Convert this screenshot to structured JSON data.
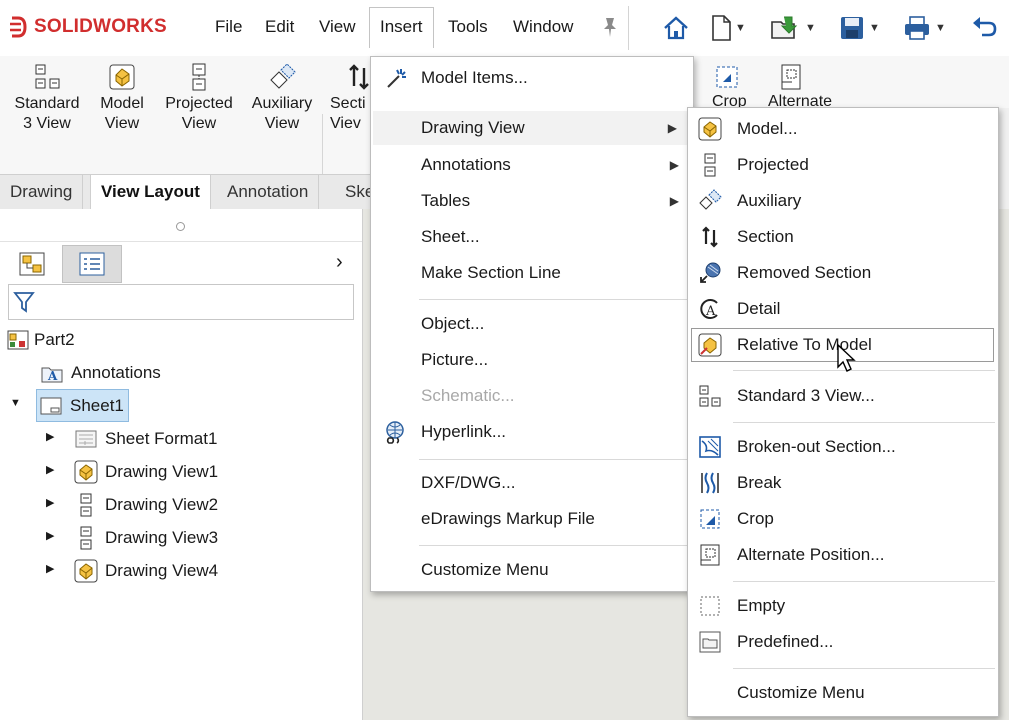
{
  "app": {
    "logo_text": "SOLIDWORKS"
  },
  "menubar": [
    "File",
    "Edit",
    "View",
    "Insert",
    "Tools",
    "Window"
  ],
  "ribbon": {
    "buttons": [
      {
        "line1": "Standard",
        "line2": "3 View"
      },
      {
        "line1": "Model",
        "line2": "View"
      },
      {
        "line1": "Projected",
        "line2": "View"
      },
      {
        "line1": "Auxiliary",
        "line2": "View"
      },
      {
        "line1": "Secti",
        "line2": "Viev"
      }
    ],
    "behind": [
      {
        "line1": "Crop"
      },
      {
        "line1": "Alternate"
      }
    ]
  },
  "tabs": [
    "Drawing",
    "View Layout",
    "Annotation",
    "Ske"
  ],
  "active_tab": "View Layout",
  "feature_tree": {
    "root": "Part2",
    "items": [
      {
        "label": "Annotations",
        "icon": "annotations-icon"
      },
      {
        "label": "Sheet1",
        "icon": "sheet-icon",
        "expanded": true,
        "selected": true
      },
      {
        "label": "Sheet Format1",
        "icon": "sheet-format-icon"
      },
      {
        "label": "Drawing View1",
        "icon": "model-view-icon"
      },
      {
        "label": "Drawing View2",
        "icon": "projected-view-icon"
      },
      {
        "label": "Drawing View3",
        "icon": "projected-view-icon"
      },
      {
        "label": "Drawing View4",
        "icon": "model-view-icon"
      }
    ]
  },
  "insert_menu": {
    "items": [
      {
        "label": "Model Items...",
        "icon": "model-items-icon"
      },
      {
        "label": "Drawing View",
        "submenu": true,
        "highlighted": true
      },
      {
        "label": "Annotations",
        "submenu": true
      },
      {
        "label": "Tables",
        "submenu": true
      },
      {
        "label": "Sheet..."
      },
      {
        "label": "Make Section Line"
      },
      {
        "label": "Object..."
      },
      {
        "label": "Picture..."
      },
      {
        "label": "Schematic...",
        "disabled": true
      },
      {
        "label": "Hyperlink...",
        "icon": "hyperlink-icon"
      },
      {
        "label": "DXF/DWG..."
      },
      {
        "label": "eDrawings Markup File"
      },
      {
        "label": "Customize Menu"
      }
    ]
  },
  "drawing_view_menu": {
    "items": [
      {
        "label": "Model...",
        "icon": "model-view-icon"
      },
      {
        "label": "Projected",
        "icon": "projected-view-icon"
      },
      {
        "label": "Auxiliary",
        "icon": "auxiliary-view-icon"
      },
      {
        "label": "Section",
        "icon": "section-view-icon"
      },
      {
        "label": "Removed Section",
        "icon": "removed-section-icon"
      },
      {
        "label": "Detail",
        "icon": "detail-view-icon"
      },
      {
        "label": "Relative To Model",
        "icon": "relative-view-icon",
        "hovered": true
      },
      {
        "label": "Standard 3 View...",
        "icon": "standard-3-view-icon"
      },
      {
        "label": "Broken-out Section...",
        "icon": "broken-out-section-icon"
      },
      {
        "label": "Break",
        "icon": "break-icon"
      },
      {
        "label": "Crop",
        "icon": "crop-icon"
      },
      {
        "label": "Alternate Position...",
        "icon": "alternate-position-icon"
      },
      {
        "label": "Empty",
        "icon": "empty-view-icon"
      },
      {
        "label": "Predefined...",
        "icon": "predefined-view-icon"
      },
      {
        "label": "Customize Menu"
      }
    ]
  },
  "colors": {
    "brand_red": "#d12e2e",
    "model_icon_yellow": "#f5c242",
    "selection_blue": "#cce4f7",
    "accent_blue": "#1e5aa8"
  }
}
